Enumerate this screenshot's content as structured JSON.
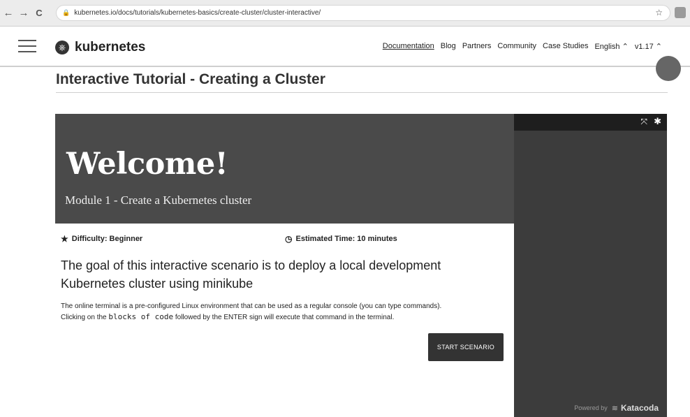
{
  "browser": {
    "url": "kubernetes.io/docs/tutorials/kubernetes-basics/create-cluster/cluster-interactive/",
    "back_icon": "←",
    "forward_icon": "→",
    "reload_icon": "C",
    "lock_icon": "🔒",
    "star_icon": "☆"
  },
  "header": {
    "logo_text": "kubernetes",
    "nav": [
      "Documentation",
      "Blog",
      "Partners",
      "Community",
      "Case Studies",
      "English ⌃",
      "v1.17 ⌃"
    ]
  },
  "page": {
    "title": "Interactive Tutorial - Creating a Cluster"
  },
  "scenario": {
    "hero_title": "Welcome!",
    "hero_subtitle": "Module 1 - Create a Kubernetes cluster",
    "difficulty": "Difficulty: Beginner",
    "estimated_time": "Estimated Time: 10 minutes",
    "goal": "The goal of this interactive scenario is to deploy a local development Kubernetes cluster using minikube",
    "desc_line1": "The online terminal is a pre-configured Linux environment that can be used as a regular console (you can type commands).",
    "desc_line2_pre": "Clicking on the ",
    "desc_line2_code": "blocks of code",
    "desc_line2_post": " followed by the ENTER sign will execute that command in the terminal.",
    "start_button": "START SCENARIO"
  },
  "terminal": {
    "powered_by": "Powered by",
    "brand": "Katacoda"
  }
}
